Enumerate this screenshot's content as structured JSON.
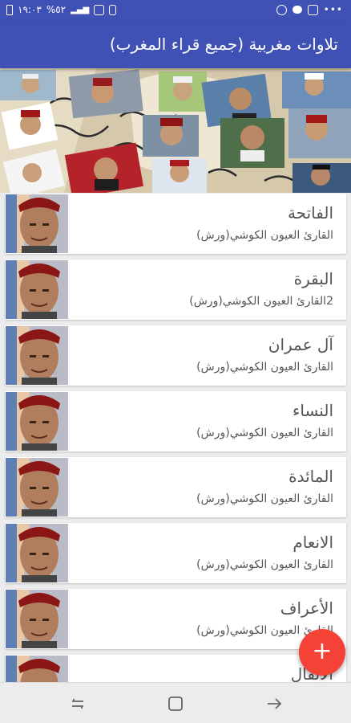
{
  "status_bar": {
    "time": "١٩:٠٣",
    "battery": "%٥٢"
  },
  "app_bar": {
    "title": "تلاوات مغربية (جميع قراء المغرب)"
  },
  "list": [
    {
      "title": "الفاتحة",
      "subtitle": "القارئ العيون الكوشي(ورش)"
    },
    {
      "title": "البقرة",
      "subtitle": "2القارئ العيون الكوشي(ورش)"
    },
    {
      "title": "آل عمران",
      "subtitle": "القارئ العيون الكوشي(ورش)"
    },
    {
      "title": "النساء",
      "subtitle": "القارئ العيون الكوشي(ورش)"
    },
    {
      "title": "المائدة",
      "subtitle": "القارئ العيون الكوشي(ورش)"
    },
    {
      "title": "الانعام",
      "subtitle": "القارئ العيون الكوشي(ورش)"
    },
    {
      "title": "الأعراف",
      "subtitle": "القارئ العيون الكوشي(ورش)"
    },
    {
      "title": "الأنفال",
      "subtitle": ""
    }
  ],
  "fab": {
    "label": "+"
  },
  "colors": {
    "primary": "#3f51b5",
    "accent": "#f44336"
  }
}
